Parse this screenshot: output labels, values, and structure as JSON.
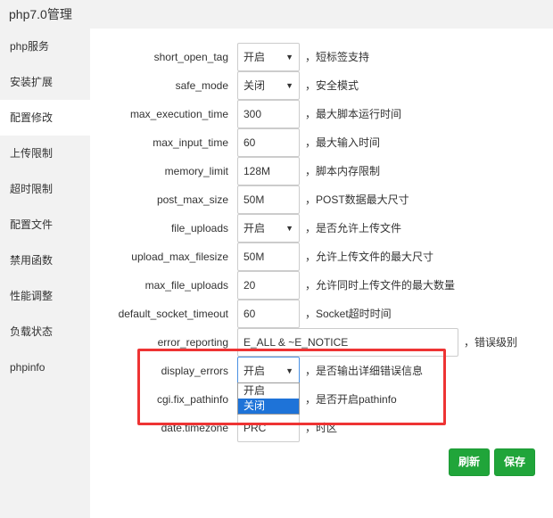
{
  "title": "php7.0管理",
  "sidebar": {
    "items": [
      {
        "label": "php服务"
      },
      {
        "label": "安装扩展"
      },
      {
        "label": "配置修改"
      },
      {
        "label": "上传限制"
      },
      {
        "label": "超时限制"
      },
      {
        "label": "配置文件"
      },
      {
        "label": "禁用函数"
      },
      {
        "label": "性能调整"
      },
      {
        "label": "负载状态"
      },
      {
        "label": "phpinfo"
      }
    ],
    "active": "配置修改"
  },
  "settings": [
    {
      "key": "short_open_tag",
      "value": "开启",
      "type": "select",
      "hint": "，短标签支持"
    },
    {
      "key": "safe_mode",
      "value": "关闭",
      "type": "select",
      "hint": "，安全模式"
    },
    {
      "key": "max_execution_time",
      "value": "300",
      "type": "input",
      "hint": "，最大脚本运行时间"
    },
    {
      "key": "max_input_time",
      "value": "60",
      "type": "input",
      "hint": "，最大输入时间"
    },
    {
      "key": "memory_limit",
      "value": "128M",
      "type": "input",
      "hint": "，脚本内存限制"
    },
    {
      "key": "post_max_size",
      "value": "50M",
      "type": "input",
      "hint": "，POST数据最大尺寸"
    },
    {
      "key": "file_uploads",
      "value": "开启",
      "type": "select",
      "hint": "，是否允许上传文件"
    },
    {
      "key": "upload_max_filesize",
      "value": "50M",
      "type": "input",
      "hint": "，允许上传文件的最大尺寸"
    },
    {
      "key": "max_file_uploads",
      "value": "20",
      "type": "input",
      "hint": "，允许同时上传文件的最大数量"
    },
    {
      "key": "default_socket_timeout",
      "value": "60",
      "type": "input",
      "hint": "，Socket超时时间"
    },
    {
      "key": "error_reporting",
      "value": "E_ALL & ~E_NOTICE",
      "type": "input",
      "hint": "，错误级别"
    },
    {
      "key": "display_errors",
      "value": "开启",
      "type": "select",
      "hint": "，是否输出详细错误信息"
    },
    {
      "key": "cgi.fix_pathinfo",
      "value": "",
      "type": "select",
      "hint": "，是否开启pathinfo"
    },
    {
      "key": "date.timezone",
      "value": "PRC",
      "type": "input",
      "hint": "，时区"
    }
  ],
  "dropdown": {
    "options": [
      "开启",
      "关闭"
    ],
    "highlighted": "关闭"
  },
  "buttons": {
    "refresh": "刷新",
    "save": "保存"
  },
  "icons": {
    "caret": "chevron-down-icon"
  },
  "colors": {
    "primary_button": "#20a53a",
    "highlight_box": "#e33333",
    "dropdown_selected": "#1e73d8"
  }
}
